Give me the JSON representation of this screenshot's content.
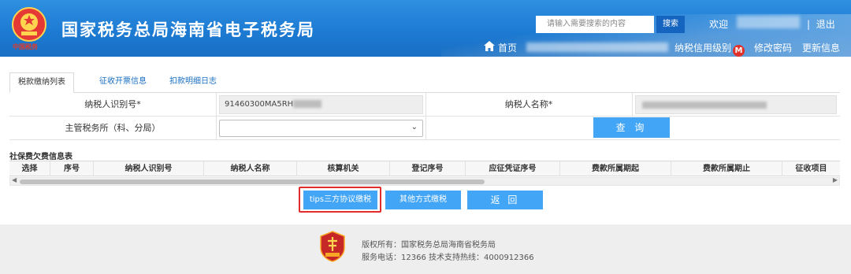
{
  "header": {
    "title": "国家税务总局海南省电子税务局",
    "emblem_subtext": "中国税务",
    "search_placeholder": "请输入需要搜索的内容",
    "search_button": "搜索",
    "welcome": "欢迎",
    "separator": "|",
    "logout": "退出",
    "home": "首页",
    "credit_level": "纳税信用级别",
    "credit_badge": "M",
    "change_password": "修改密码",
    "update_info": "更新信息"
  },
  "tabs": [
    {
      "label": "税款缴纳列表",
      "active": true
    },
    {
      "label": "征收开票信息",
      "active": false
    },
    {
      "label": "扣款明细日志",
      "active": false
    }
  ],
  "form": {
    "taxpayer_id_label": "纳税人识别号*",
    "taxpayer_id_value": "91460300MA5RH",
    "taxpayer_name_label": "纳税人名称*",
    "tax_office_label": "主管税务所（科、分局）",
    "tax_office_value": "",
    "query_button": "查 询"
  },
  "section_title": "社保费欠费信息表",
  "grid_columns": [
    "选择",
    "序号",
    "纳税人识别号",
    "纳税人名称",
    "核算机关",
    "登记序号",
    "应征凭证序号",
    "费款所属期起",
    "费款所属期止",
    "征收项目"
  ],
  "actions": {
    "tips_pay": "tips三方协议缴税",
    "other_pay": "其他方式缴税",
    "back": "返 回"
  },
  "footer": {
    "copyright": "版权所有：国家税务总局海南省税务局",
    "service": "服务电话：12366 技术支持热线：4000912366"
  },
  "colors": {
    "header_blue": "#1d7bd3",
    "button_blue": "#42a5f5",
    "highlight_red": "#e22b2b"
  }
}
